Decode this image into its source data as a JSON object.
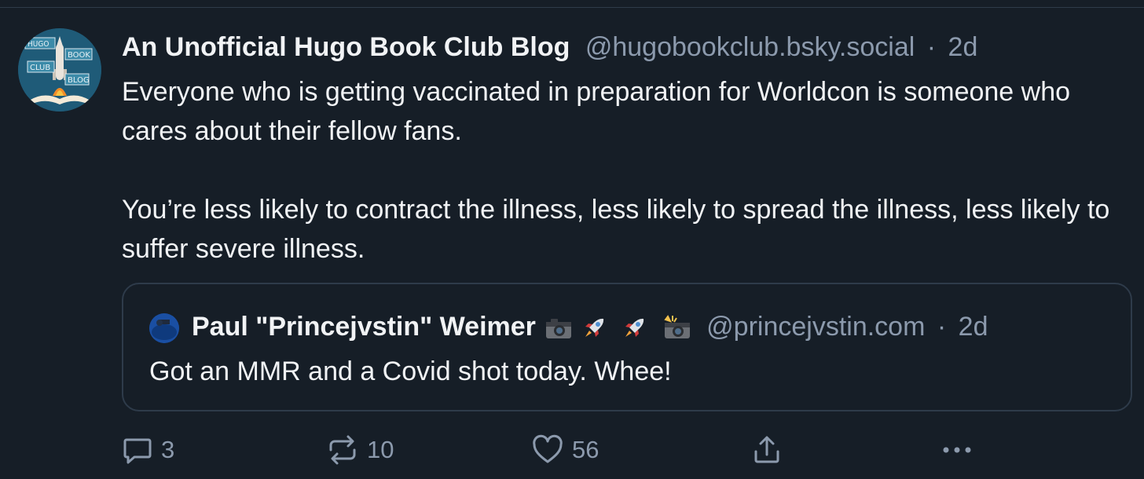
{
  "post": {
    "author": {
      "display_name": "An Unofficial Hugo Book Club Blog",
      "handle": "@hugobookclub.bsky.social",
      "avatar_words": [
        "HUGO",
        "BOOK",
        "CLUB",
        "BLOG"
      ]
    },
    "separator": "·",
    "timestamp": "2d",
    "text_paragraphs": [
      "Everyone who is getting vaccinated in preparation for Worldcon is someone who cares about their fellow fans.",
      "You’re less likely to contract the illness, less likely to spread the illness, less likely to suffer severe illness."
    ],
    "quote": {
      "display_name": "Paul \"Princejvstin\" Weimer",
      "name_emoji": [
        "camera-icon",
        "rocket-icon",
        "rocket-icon",
        "camera-flash-icon"
      ],
      "handle": "@princejvstin.com",
      "separator": "·",
      "timestamp": "2d",
      "text": "Got an MMR and a Covid shot today. Whee!"
    },
    "actions": {
      "reply_count": "3",
      "repost_count": "10",
      "like_count": "56"
    }
  },
  "colors": {
    "background": "#161e27",
    "text_primary": "#f1f3f5",
    "text_secondary": "#8c9aad",
    "border": "#2e3b4a"
  }
}
